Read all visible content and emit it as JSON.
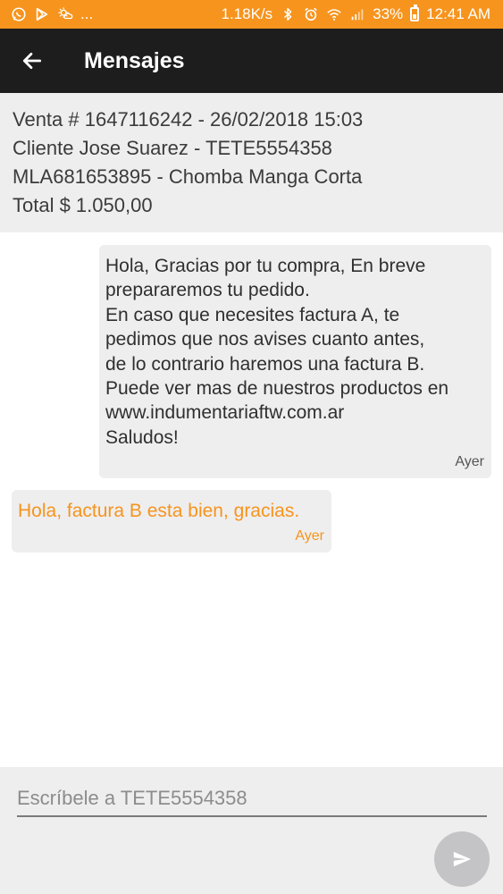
{
  "status_bar": {
    "notifications_more": "...",
    "network_speed": "1.18K/s",
    "battery_percent": "33%",
    "time": "12:41 AM",
    "icons": [
      "whatsapp-icon",
      "play-store-icon",
      "weather-icon",
      "bluetooth-icon",
      "alarm-icon",
      "wifi-icon",
      "signal-icon",
      "battery-icon"
    ]
  },
  "app_bar": {
    "title": "Mensajes",
    "back_icon": "arrow-left-icon"
  },
  "order": {
    "sale_line": "Venta # 1647116242 - 26/02/2018 15:03",
    "client_line": "Cliente Jose Suarez - TETE5554358",
    "item_line": "MLA681653895 - Chomba Manga Corta",
    "total_line": "Total $ 1.050,00"
  },
  "messages": [
    {
      "direction": "outgoing",
      "text": "Hola, Gracias por tu compra, En breve\nprepararemos tu pedido.\nEn caso que necesites factura A, te\npedimos que nos avises cuanto antes,\nde lo contrario haremos una factura B.\nPuede ver mas de nuestros productos en\nwww.indumentariaftw.com.ar\nSaludos!",
      "time": "Ayer"
    },
    {
      "direction": "incoming",
      "text": "Hola, factura B esta bien, gracias.",
      "time": "Ayer"
    }
  ],
  "compose": {
    "placeholder": "Escríbele a TETE5554358",
    "value": "",
    "send_icon": "send-icon"
  },
  "colors": {
    "accent": "#f6941d",
    "app_bar": "#1d1d1d",
    "panel": "#eeeeef",
    "send_button": "#c4c4c6"
  }
}
